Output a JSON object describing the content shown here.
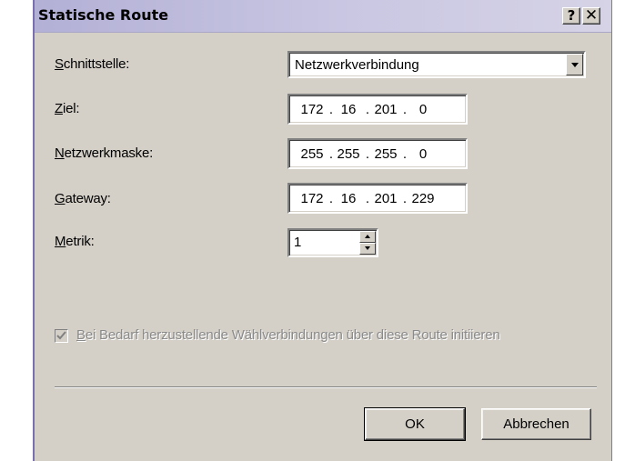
{
  "window": {
    "title": "Statische Route",
    "help_label": "?",
    "close_label": "✕"
  },
  "fields": {
    "interface": {
      "label_accel": "S",
      "label_rest": "chnittstelle:",
      "value": "Netzwerkverbindung"
    },
    "destination": {
      "label_accel": "Z",
      "label_rest": "iel:",
      "octets": [
        "172",
        "16",
        "201",
        "0"
      ]
    },
    "netmask": {
      "label_accel": "N",
      "label_rest": "etzwerkmaske:",
      "octets": [
        "255",
        "255",
        "255",
        "0"
      ]
    },
    "gateway": {
      "label_accel": "G",
      "label_rest": "ateway:",
      "octets": [
        "172",
        "16",
        "201",
        "229"
      ]
    },
    "metric": {
      "label_accel": "M",
      "label_rest": "etrik:",
      "value": "1"
    }
  },
  "dial_on_demand": {
    "accel": "B",
    "rest": "ei Bedarf herzustellende Wählverbindungen über diese Route initiieren",
    "checked": true,
    "enabled": false
  },
  "buttons": {
    "ok": "OK",
    "cancel": "Abbrechen"
  },
  "colors": {
    "dialog_face": "#d4d0c8",
    "title_gradient_start": "#b3b0d6",
    "disabled_text": "#8a8a8a"
  },
  "icons": {
    "dropdown": "chevron-down-icon",
    "spin_up": "arrow-up-icon",
    "spin_down": "arrow-down-icon",
    "checkmark": "checkmark-icon"
  }
}
